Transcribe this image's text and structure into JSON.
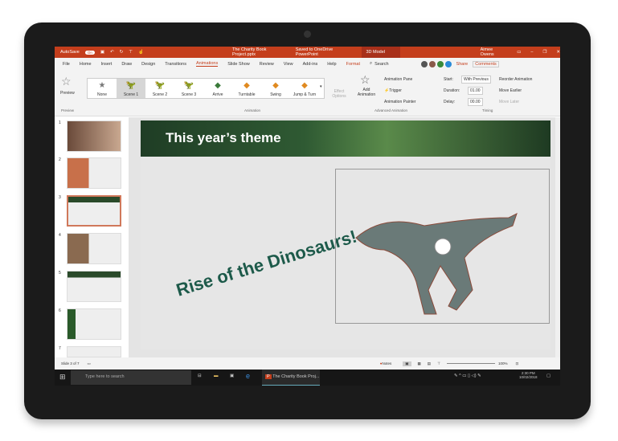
{
  "titlebar": {
    "autosave": "AutoSave",
    "autosave_state": "On",
    "doc": "The Charity Book Project.pptx",
    "saved": "Saved to OneDrive PowerPoint",
    "context_tab": "3D Model Tools",
    "user": "Aimee Owens"
  },
  "tabs": [
    "File",
    "Home",
    "Insert",
    "Draw",
    "Design",
    "Transitions",
    "Animations",
    "Slide Show",
    "Review",
    "View",
    "Add-ins",
    "Help",
    "Format"
  ],
  "search": "Search",
  "share": "Share",
  "comments": "Comments",
  "ribbon": {
    "preview": "Preview",
    "gallery": [
      "None",
      "Scene 1",
      "Scene 2",
      "Scene 3",
      "Arrive",
      "Turntable",
      "Swing",
      "Jump & Turn"
    ],
    "effect_options": "Effect Options",
    "add_animation": "Add Animation",
    "animation_pane": "Animation Pane",
    "trigger": "Trigger",
    "animation_painter": "Animation Painter",
    "start_label": "Start:",
    "start_value": "With Previous",
    "duration_label": "Duration:",
    "duration_value": "01.00",
    "delay_label": "Delay:",
    "delay_value": "00.00",
    "reorder": "Reorder Animation",
    "move_earlier": "Move Earlier",
    "move_later": "Move Later",
    "groups": {
      "preview": "Preview",
      "animation": "Animation",
      "advanced": "Advanced Animation",
      "timing": "Timing"
    }
  },
  "slides": [
    "1",
    "2",
    "3",
    "4",
    "5",
    "6",
    "7"
  ],
  "slide": {
    "title": "This year’s theme",
    "text": "Rise of the Dinosaurs!"
  },
  "status": {
    "slide": "Slide 3 of 7",
    "notes": "Notes",
    "zoom": "100%"
  },
  "taskbar": {
    "search": "Type here to search",
    "app": "The Charity Book Proj...",
    "time": "2:30 PM",
    "date": "10/02/2018"
  },
  "colors": {
    "accent": "#c43e1c"
  }
}
